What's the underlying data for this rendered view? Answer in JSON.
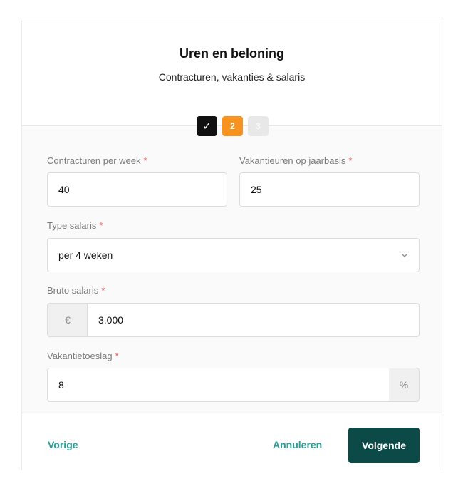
{
  "header": {
    "title": "Uren en beloning",
    "subtitle": "Contracturen, vakanties & salaris"
  },
  "steps": [
    {
      "label": "✓",
      "state": "done"
    },
    {
      "label": "2",
      "state": "active"
    },
    {
      "label": "3",
      "state": "todo"
    }
  ],
  "form": {
    "contract_hours": {
      "label": "Contracturen per week",
      "required": "*",
      "value": "40"
    },
    "vacation_hours": {
      "label": "Vakantieuren op jaarbasis",
      "required": "*",
      "value": "25"
    },
    "salary_type": {
      "label": "Type salaris",
      "required": "*",
      "value": "per 4 weken"
    },
    "gross_salary": {
      "label": "Bruto salaris",
      "required": "*",
      "prefix": "€",
      "value": "3.000"
    },
    "holiday_pay": {
      "label": "Vakantietoeslag",
      "required": "*",
      "value": "8",
      "suffix": "%"
    }
  },
  "footer": {
    "back_label": "Vorige",
    "cancel_label": "Annuleren",
    "next_label": "Volgende"
  },
  "colors": {
    "accent_teal": "#2a9d95",
    "primary_dark": "#0c4a48",
    "step_active": "#f7931e",
    "required": "#e85c5c"
  },
  "icons": {
    "select_arrow": "chevron-down-icon",
    "done_step": "check-icon"
  }
}
